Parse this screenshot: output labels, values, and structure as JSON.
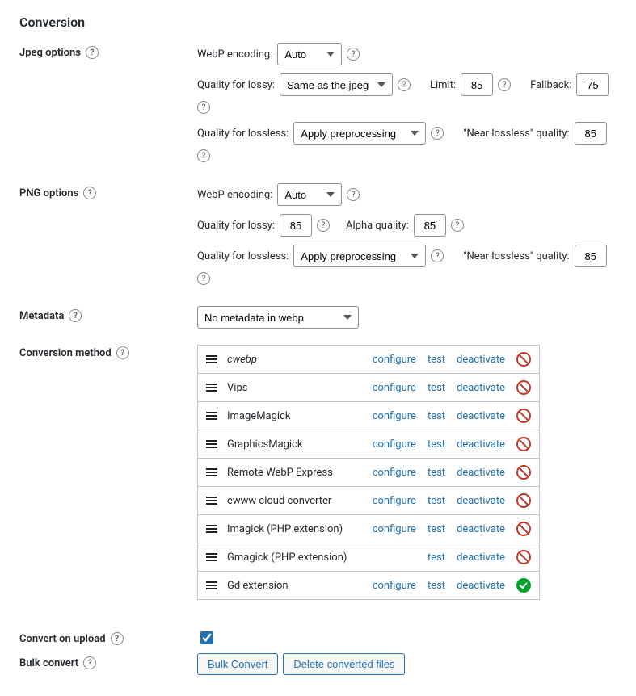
{
  "title": "Conversion",
  "labels": {
    "jpeg_options": "Jpeg options",
    "png_options": "PNG options",
    "metadata": "Metadata",
    "conversion_method": "Conversion method",
    "convert_on_upload": "Convert on upload",
    "bulk_convert": "Bulk convert",
    "webp_encoding": "WebP encoding:",
    "quality_lossy": "Quality for lossy:",
    "quality_lossless": "Quality for lossless:",
    "limit": "Limit:",
    "fallback": "Fallback:",
    "near_lossless": "\"Near lossless\" quality:",
    "alpha_quality": "Alpha quality:"
  },
  "actions": {
    "configure": "configure",
    "test": "test",
    "deactivate": "deactivate",
    "bulk_convert_btn": "Bulk Convert",
    "delete_converted_btn": "Delete converted files"
  },
  "jpeg": {
    "encoding": "Auto",
    "quality_lossy": "Same as the jpeg",
    "limit": "85",
    "fallback": "75",
    "quality_lossless": "Apply preprocessing",
    "near_lossless_quality": "85"
  },
  "png": {
    "encoding": "Auto",
    "quality_lossy": "85",
    "alpha_quality": "85",
    "quality_lossless": "Apply preprocessing",
    "near_lossless_quality": "85"
  },
  "metadata_value": "No metadata in webp",
  "methods": [
    {
      "name": "cwebp",
      "italic": true,
      "status": "blocked",
      "has_configure": true
    },
    {
      "name": "Vips",
      "italic": false,
      "status": "blocked",
      "has_configure": true
    },
    {
      "name": "ImageMagick",
      "italic": false,
      "status": "blocked",
      "has_configure": true
    },
    {
      "name": "GraphicsMagick",
      "italic": false,
      "status": "blocked",
      "has_configure": true
    },
    {
      "name": "Remote WebP Express",
      "italic": false,
      "status": "blocked",
      "has_configure": true
    },
    {
      "name": "ewww cloud converter",
      "italic": false,
      "status": "blocked",
      "has_configure": true
    },
    {
      "name": "Imagick (PHP extension)",
      "italic": false,
      "status": "blocked",
      "has_configure": true
    },
    {
      "name": "Gmagick (PHP extension)",
      "italic": false,
      "status": "blocked",
      "has_configure": false
    },
    {
      "name": "Gd extension",
      "italic": false,
      "status": "ok",
      "has_configure": true
    }
  ]
}
